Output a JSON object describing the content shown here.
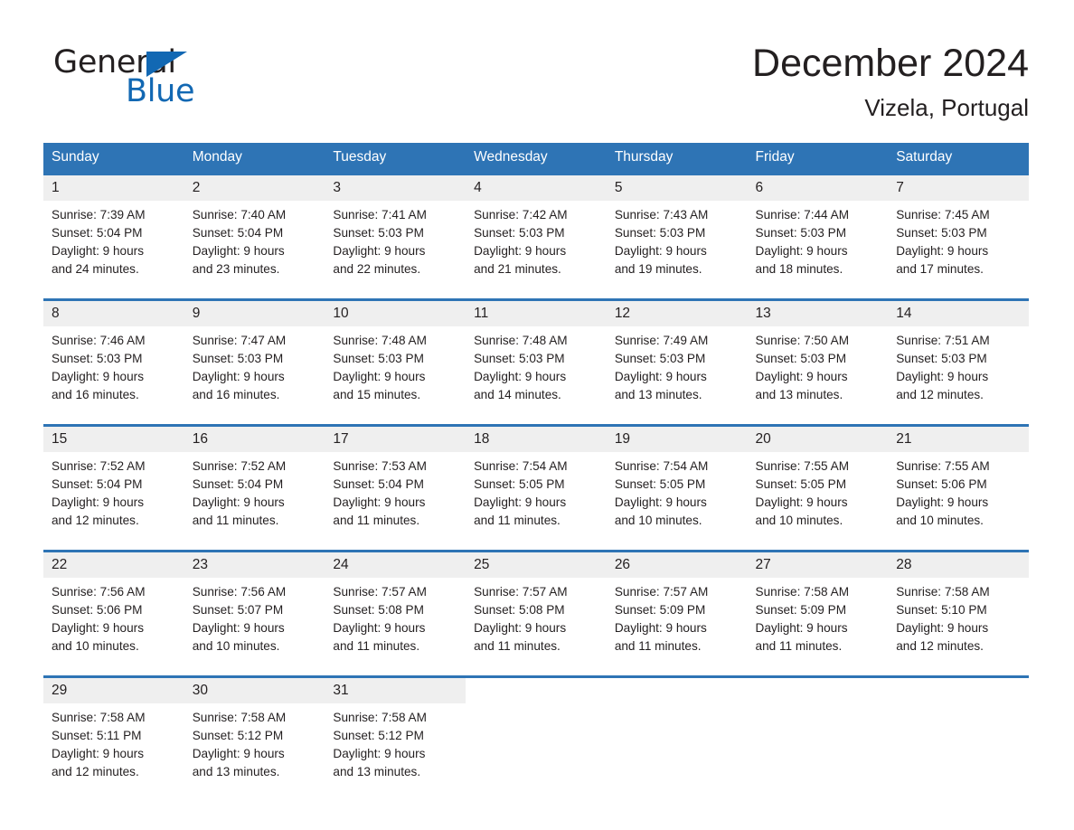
{
  "brand": {
    "word_one": "General",
    "word_two": "Blue",
    "triangle_color": "#1268b3",
    "text_color": "#231f20"
  },
  "header": {
    "title": "December 2024",
    "location": "Vizela, Portugal"
  },
  "theme": {
    "header_row_bg": "#2e74b5",
    "header_row_text": "#ffffff",
    "daynum_bg": "#efefef",
    "separator": "#2e74b5",
    "page_bg": "#ffffff"
  },
  "weekdays": [
    "Sunday",
    "Monday",
    "Tuesday",
    "Wednesday",
    "Thursday",
    "Friday",
    "Saturday"
  ],
  "weeks": [
    [
      {
        "day": "1",
        "sunrise": "Sunrise: 7:39 AM",
        "sunset": "Sunset: 5:04 PM",
        "daylight_1": "Daylight: 9 hours",
        "daylight_2": "and 24 minutes."
      },
      {
        "day": "2",
        "sunrise": "Sunrise: 7:40 AM",
        "sunset": "Sunset: 5:04 PM",
        "daylight_1": "Daylight: 9 hours",
        "daylight_2": "and 23 minutes."
      },
      {
        "day": "3",
        "sunrise": "Sunrise: 7:41 AM",
        "sunset": "Sunset: 5:03 PM",
        "daylight_1": "Daylight: 9 hours",
        "daylight_2": "and 22 minutes."
      },
      {
        "day": "4",
        "sunrise": "Sunrise: 7:42 AM",
        "sunset": "Sunset: 5:03 PM",
        "daylight_1": "Daylight: 9 hours",
        "daylight_2": "and 21 minutes."
      },
      {
        "day": "5",
        "sunrise": "Sunrise: 7:43 AM",
        "sunset": "Sunset: 5:03 PM",
        "daylight_1": "Daylight: 9 hours",
        "daylight_2": "and 19 minutes."
      },
      {
        "day": "6",
        "sunrise": "Sunrise: 7:44 AM",
        "sunset": "Sunset: 5:03 PM",
        "daylight_1": "Daylight: 9 hours",
        "daylight_2": "and 18 minutes."
      },
      {
        "day": "7",
        "sunrise": "Sunrise: 7:45 AM",
        "sunset": "Sunset: 5:03 PM",
        "daylight_1": "Daylight: 9 hours",
        "daylight_2": "and 17 minutes."
      }
    ],
    [
      {
        "day": "8",
        "sunrise": "Sunrise: 7:46 AM",
        "sunset": "Sunset: 5:03 PM",
        "daylight_1": "Daylight: 9 hours",
        "daylight_2": "and 16 minutes."
      },
      {
        "day": "9",
        "sunrise": "Sunrise: 7:47 AM",
        "sunset": "Sunset: 5:03 PM",
        "daylight_1": "Daylight: 9 hours",
        "daylight_2": "and 16 minutes."
      },
      {
        "day": "10",
        "sunrise": "Sunrise: 7:48 AM",
        "sunset": "Sunset: 5:03 PM",
        "daylight_1": "Daylight: 9 hours",
        "daylight_2": "and 15 minutes."
      },
      {
        "day": "11",
        "sunrise": "Sunrise: 7:48 AM",
        "sunset": "Sunset: 5:03 PM",
        "daylight_1": "Daylight: 9 hours",
        "daylight_2": "and 14 minutes."
      },
      {
        "day": "12",
        "sunrise": "Sunrise: 7:49 AM",
        "sunset": "Sunset: 5:03 PM",
        "daylight_1": "Daylight: 9 hours",
        "daylight_2": "and 13 minutes."
      },
      {
        "day": "13",
        "sunrise": "Sunrise: 7:50 AM",
        "sunset": "Sunset: 5:03 PM",
        "daylight_1": "Daylight: 9 hours",
        "daylight_2": "and 13 minutes."
      },
      {
        "day": "14",
        "sunrise": "Sunrise: 7:51 AM",
        "sunset": "Sunset: 5:03 PM",
        "daylight_1": "Daylight: 9 hours",
        "daylight_2": "and 12 minutes."
      }
    ],
    [
      {
        "day": "15",
        "sunrise": "Sunrise: 7:52 AM",
        "sunset": "Sunset: 5:04 PM",
        "daylight_1": "Daylight: 9 hours",
        "daylight_2": "and 12 minutes."
      },
      {
        "day": "16",
        "sunrise": "Sunrise: 7:52 AM",
        "sunset": "Sunset: 5:04 PM",
        "daylight_1": "Daylight: 9 hours",
        "daylight_2": "and 11 minutes."
      },
      {
        "day": "17",
        "sunrise": "Sunrise: 7:53 AM",
        "sunset": "Sunset: 5:04 PM",
        "daylight_1": "Daylight: 9 hours",
        "daylight_2": "and 11 minutes."
      },
      {
        "day": "18",
        "sunrise": "Sunrise: 7:54 AM",
        "sunset": "Sunset: 5:05 PM",
        "daylight_1": "Daylight: 9 hours",
        "daylight_2": "and 11 minutes."
      },
      {
        "day": "19",
        "sunrise": "Sunrise: 7:54 AM",
        "sunset": "Sunset: 5:05 PM",
        "daylight_1": "Daylight: 9 hours",
        "daylight_2": "and 10 minutes."
      },
      {
        "day": "20",
        "sunrise": "Sunrise: 7:55 AM",
        "sunset": "Sunset: 5:05 PM",
        "daylight_1": "Daylight: 9 hours",
        "daylight_2": "and 10 minutes."
      },
      {
        "day": "21",
        "sunrise": "Sunrise: 7:55 AM",
        "sunset": "Sunset: 5:06 PM",
        "daylight_1": "Daylight: 9 hours",
        "daylight_2": "and 10 minutes."
      }
    ],
    [
      {
        "day": "22",
        "sunrise": "Sunrise: 7:56 AM",
        "sunset": "Sunset: 5:06 PM",
        "daylight_1": "Daylight: 9 hours",
        "daylight_2": "and 10 minutes."
      },
      {
        "day": "23",
        "sunrise": "Sunrise: 7:56 AM",
        "sunset": "Sunset: 5:07 PM",
        "daylight_1": "Daylight: 9 hours",
        "daylight_2": "and 10 minutes."
      },
      {
        "day": "24",
        "sunrise": "Sunrise: 7:57 AM",
        "sunset": "Sunset: 5:08 PM",
        "daylight_1": "Daylight: 9 hours",
        "daylight_2": "and 11 minutes."
      },
      {
        "day": "25",
        "sunrise": "Sunrise: 7:57 AM",
        "sunset": "Sunset: 5:08 PM",
        "daylight_1": "Daylight: 9 hours",
        "daylight_2": "and 11 minutes."
      },
      {
        "day": "26",
        "sunrise": "Sunrise: 7:57 AM",
        "sunset": "Sunset: 5:09 PM",
        "daylight_1": "Daylight: 9 hours",
        "daylight_2": "and 11 minutes."
      },
      {
        "day": "27",
        "sunrise": "Sunrise: 7:58 AM",
        "sunset": "Sunset: 5:09 PM",
        "daylight_1": "Daylight: 9 hours",
        "daylight_2": "and 11 minutes."
      },
      {
        "day": "28",
        "sunrise": "Sunrise: 7:58 AM",
        "sunset": "Sunset: 5:10 PM",
        "daylight_1": "Daylight: 9 hours",
        "daylight_2": "and 12 minutes."
      }
    ],
    [
      {
        "day": "29",
        "sunrise": "Sunrise: 7:58 AM",
        "sunset": "Sunset: 5:11 PM",
        "daylight_1": "Daylight: 9 hours",
        "daylight_2": "and 12 minutes."
      },
      {
        "day": "30",
        "sunrise": "Sunrise: 7:58 AM",
        "sunset": "Sunset: 5:12 PM",
        "daylight_1": "Daylight: 9 hours",
        "daylight_2": "and 13 minutes."
      },
      {
        "day": "31",
        "sunrise": "Sunrise: 7:58 AM",
        "sunset": "Sunset: 5:12 PM",
        "daylight_1": "Daylight: 9 hours",
        "daylight_2": "and 13 minutes."
      },
      null,
      null,
      null,
      null
    ]
  ]
}
